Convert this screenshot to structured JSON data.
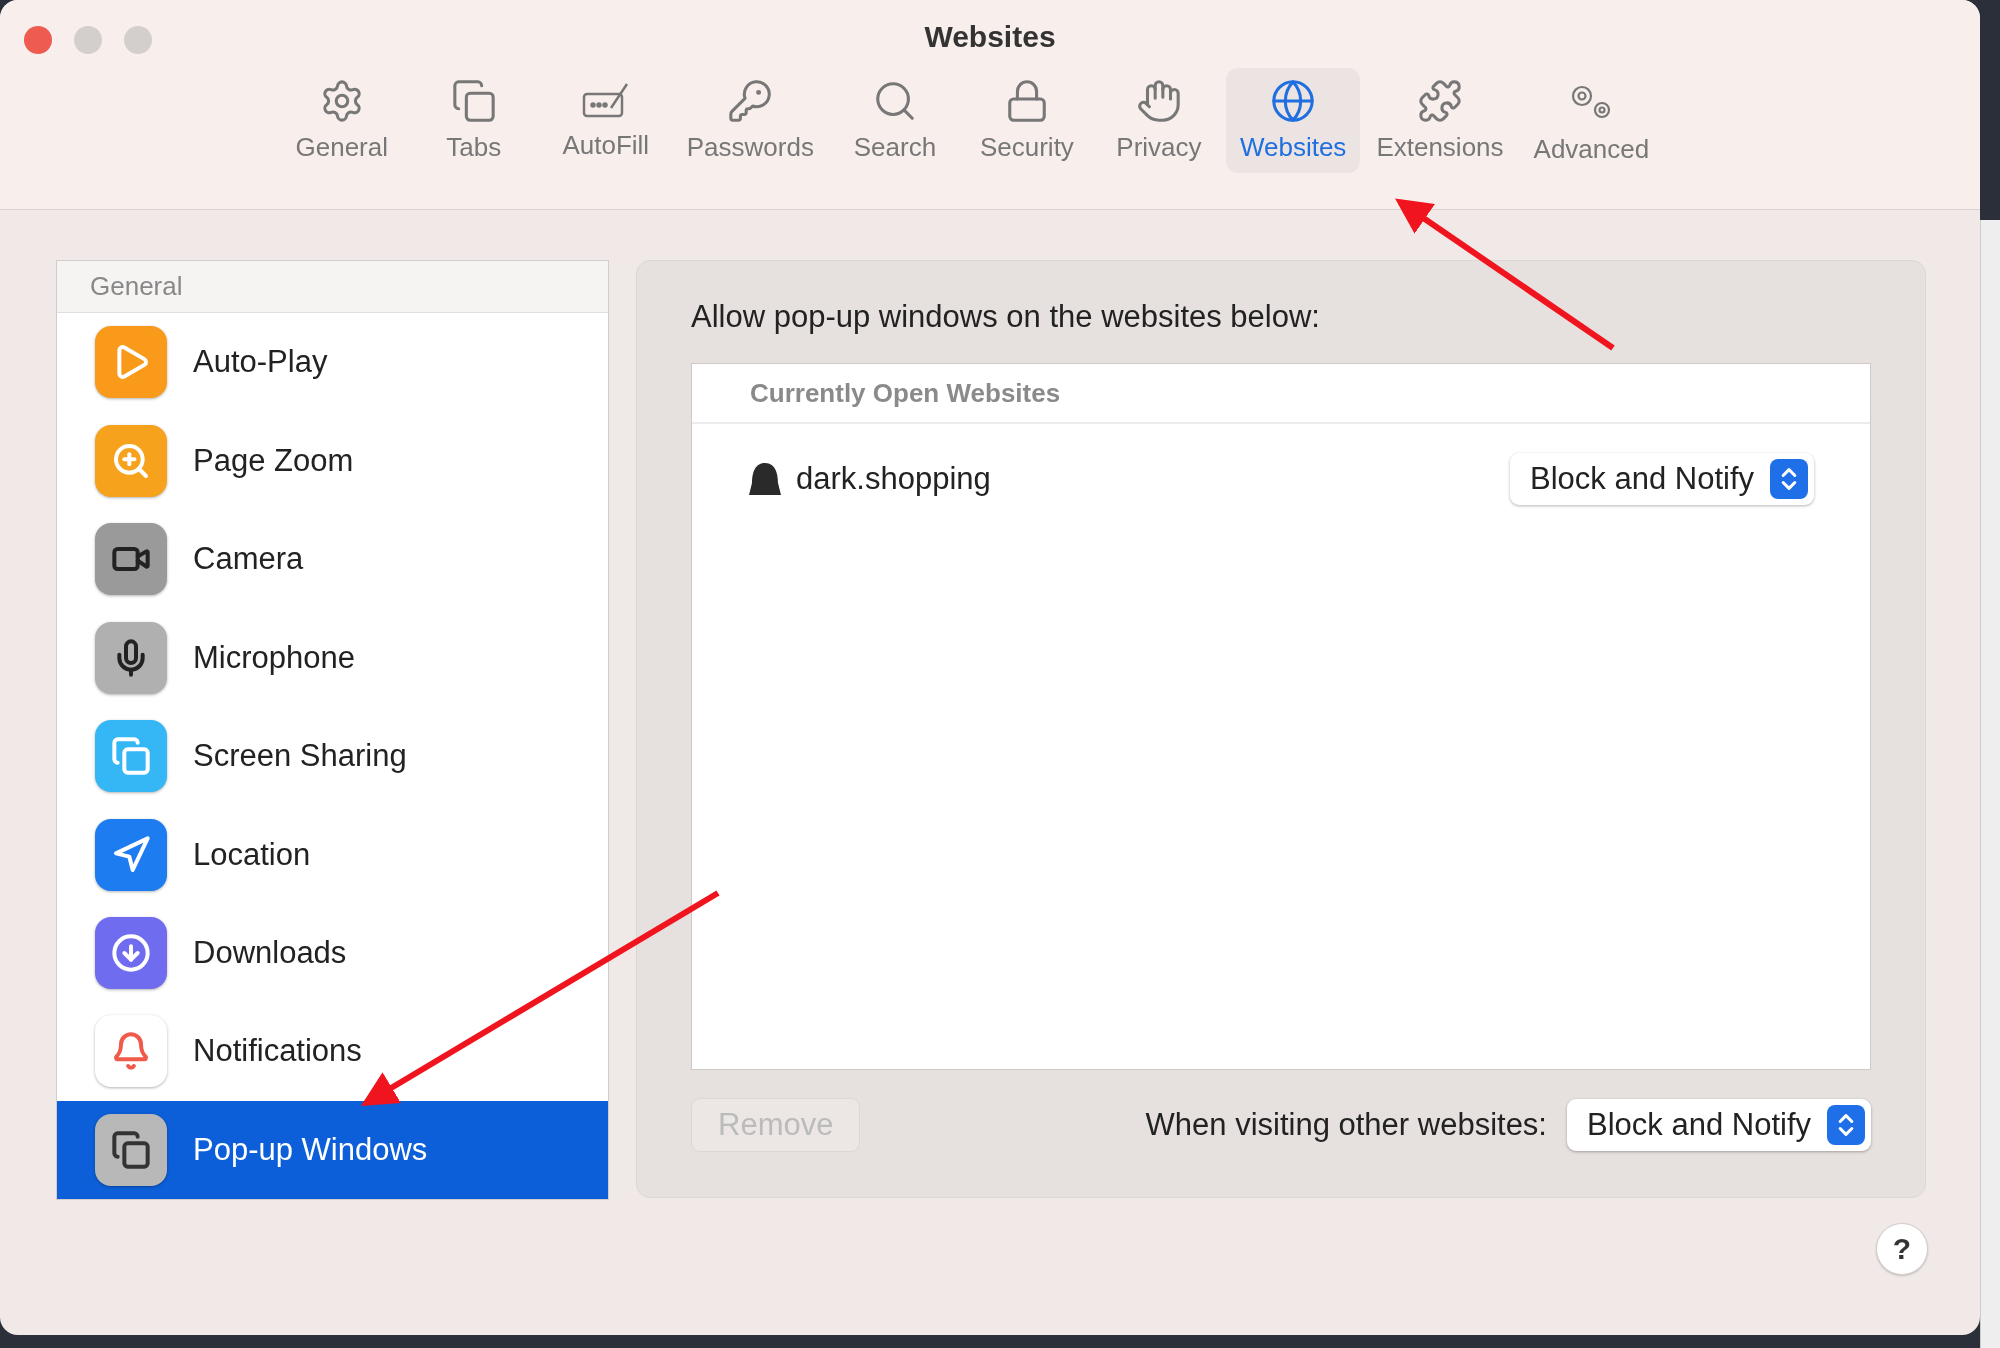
{
  "window": {
    "title": "Websites"
  },
  "toolbar": [
    {
      "label": "General",
      "selected": false
    },
    {
      "label": "Tabs",
      "selected": false
    },
    {
      "label": "AutoFill",
      "selected": false
    },
    {
      "label": "Passwords",
      "selected": false
    },
    {
      "label": "Search",
      "selected": false
    },
    {
      "label": "Security",
      "selected": false
    },
    {
      "label": "Privacy",
      "selected": false
    },
    {
      "label": "Websites",
      "selected": true
    },
    {
      "label": "Extensions",
      "selected": false
    },
    {
      "label": "Advanced",
      "selected": false
    }
  ],
  "sidebar": {
    "header": "General",
    "items": [
      {
        "label": "Auto-Play",
        "selected": false
      },
      {
        "label": "Page Zoom",
        "selected": false
      },
      {
        "label": "Camera",
        "selected": false
      },
      {
        "label": "Microphone",
        "selected": false
      },
      {
        "label": "Screen Sharing",
        "selected": false
      },
      {
        "label": "Location",
        "selected": false
      },
      {
        "label": "Downloads",
        "selected": false
      },
      {
        "label": "Notifications",
        "selected": false
      },
      {
        "label": "Pop-up Windows",
        "selected": true
      }
    ]
  },
  "panel": {
    "heading": "Allow pop-up windows on the websites below:",
    "table_header": "Currently Open Websites",
    "sites": [
      {
        "name": "dark.shopping",
        "setting": "Block and Notify"
      }
    ],
    "remove_button": {
      "label": "Remove",
      "disabled": true
    },
    "other_label": "When visiting other websites:",
    "other_setting": "Block and Notify"
  },
  "help_button": "?"
}
